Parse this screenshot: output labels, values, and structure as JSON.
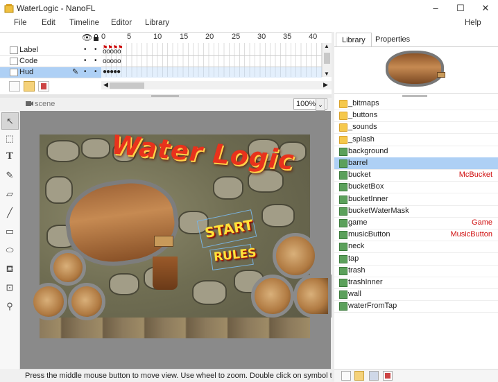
{
  "window": {
    "title": "WaterLogic - NanoFL",
    "controls": [
      "–",
      "☐",
      "✕"
    ]
  },
  "menu": [
    "File",
    "Edit",
    "Timeline",
    "Editor",
    "Library",
    "Help"
  ],
  "timeline": {
    "layers": [
      {
        "name": "Label",
        "frames": "ooooo"
      },
      {
        "name": "Code",
        "frames": "ooooo"
      },
      {
        "name": "Hud",
        "frames": "●●●●●",
        "selected": true
      }
    ],
    "ruler": [
      "0",
      "5",
      "10",
      "15",
      "20",
      "25",
      "30",
      "35",
      "40"
    ]
  },
  "stage": {
    "scene_label": "scene",
    "zoom": "100%",
    "canvas": {
      "title": "Water Logic",
      "start_button": "START",
      "rules_button": "RULES"
    }
  },
  "status": "Press the middle mouse button to move view. Use wheel to zoom. Double click on symbol to edit....",
  "right_panel": {
    "tabs": [
      "Library",
      "Properties"
    ],
    "active_tab": "Library",
    "items": [
      {
        "name": "_bitmaps",
        "type": "folder",
        "link": ""
      },
      {
        "name": "_buttons",
        "type": "folder",
        "link": ""
      },
      {
        "name": "_sounds",
        "type": "folder",
        "link": ""
      },
      {
        "name": "_splash",
        "type": "folder",
        "link": ""
      },
      {
        "name": "background",
        "type": "symbol",
        "link": ""
      },
      {
        "name": "barrel",
        "type": "symbol",
        "link": "",
        "selected": true
      },
      {
        "name": "bucket",
        "type": "symbol",
        "link": "McBucket"
      },
      {
        "name": "bucketBox",
        "type": "symbol",
        "link": ""
      },
      {
        "name": "bucketInner",
        "type": "symbol",
        "link": ""
      },
      {
        "name": "bucketWaterMask",
        "type": "symbol",
        "link": ""
      },
      {
        "name": "game",
        "type": "symbol",
        "link": "Game"
      },
      {
        "name": "musicButton",
        "type": "symbol",
        "link": "MusicButton"
      },
      {
        "name": "neck",
        "type": "symbol",
        "link": ""
      },
      {
        "name": "tap",
        "type": "symbol",
        "link": ""
      },
      {
        "name": "trash",
        "type": "symbol",
        "link": ""
      },
      {
        "name": "trashInner",
        "type": "symbol",
        "link": ""
      },
      {
        "name": "wall",
        "type": "symbol",
        "link": ""
      },
      {
        "name": "waterFromTap",
        "type": "symbol",
        "link": ""
      }
    ]
  },
  "colors": {
    "selection": "#aed0f5",
    "linkage_text": "#d01010",
    "folder": "#f5c84c",
    "symbol": "#5ba05b"
  }
}
